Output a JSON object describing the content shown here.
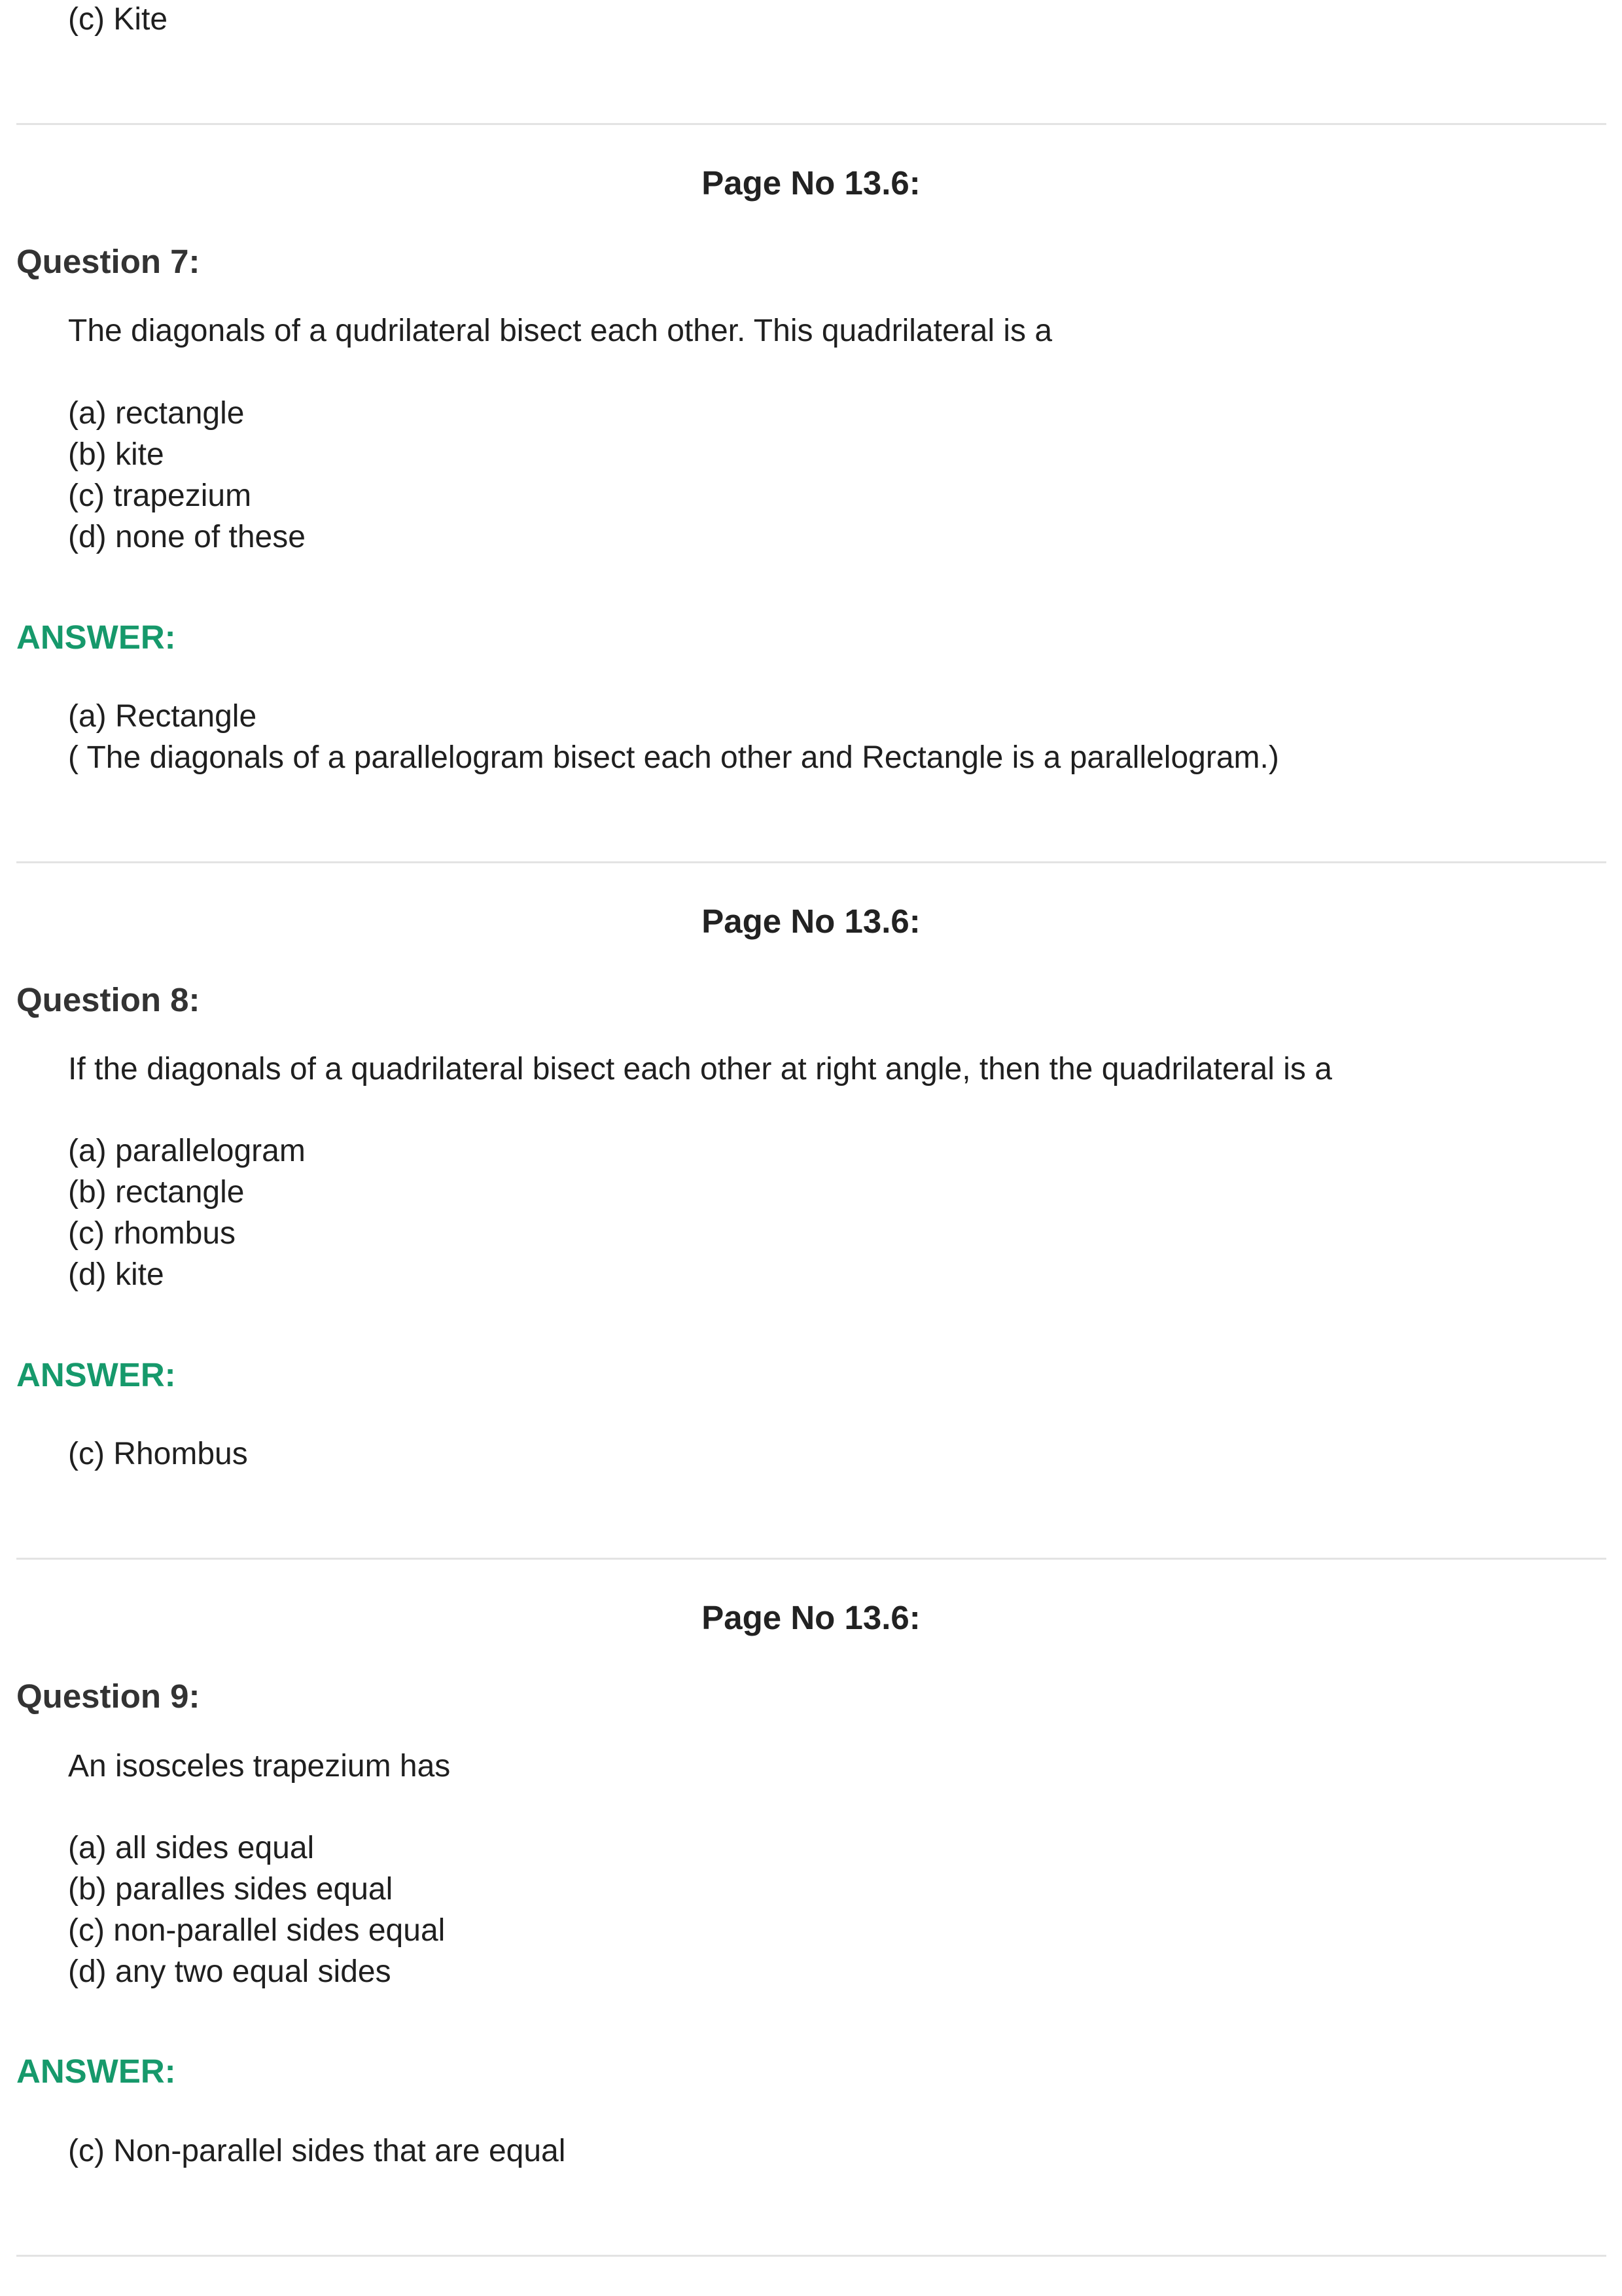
{
  "top_fragment": "(c) Kite",
  "sections": [
    {
      "page_no": "Page No 13.6:",
      "question_label": "Question 7:",
      "question_text": "The diagonals of a qudrilateral bisect each other. This quadrilateral is a",
      "options": [
        "(a) rectangle",
        "(b) kite",
        "(c) trapezium",
        "(d) none of these"
      ],
      "answer_label": "ANSWER:",
      "answer_lines": [
        "(a) Rectangle",
        "( The diagonals of a parallelogram bisect each other and Rectangle is a parallelogram.)"
      ]
    },
    {
      "page_no": "Page No 13.6:",
      "question_label": "Question 8:",
      "question_text": "If the diagonals of a quadrilateral bisect each other at right angle, then the quadrilateral is a",
      "options": [
        "(a) parallelogram",
        "(b) rectangle",
        "(c) rhombus",
        "(d) kite"
      ],
      "answer_label": "ANSWER:",
      "answer_lines": [
        "(c) Rhombus"
      ]
    },
    {
      "page_no": "Page No 13.6:",
      "question_label": "Question 9:",
      "question_text": "An isosceles trapezium has",
      "options": [
        "(a) all sides equal",
        "(b) paralles sides equal",
        "(c) non-parallel sides equal",
        "(d) any two equal sides"
      ],
      "answer_label": "ANSWER:",
      "answer_lines": [
        "(c) Non-parallel sides that are equal"
      ]
    }
  ],
  "colors": {
    "answer_heading": "#16996b",
    "question_heading": "#333333",
    "divider": "#e3e3e3"
  }
}
